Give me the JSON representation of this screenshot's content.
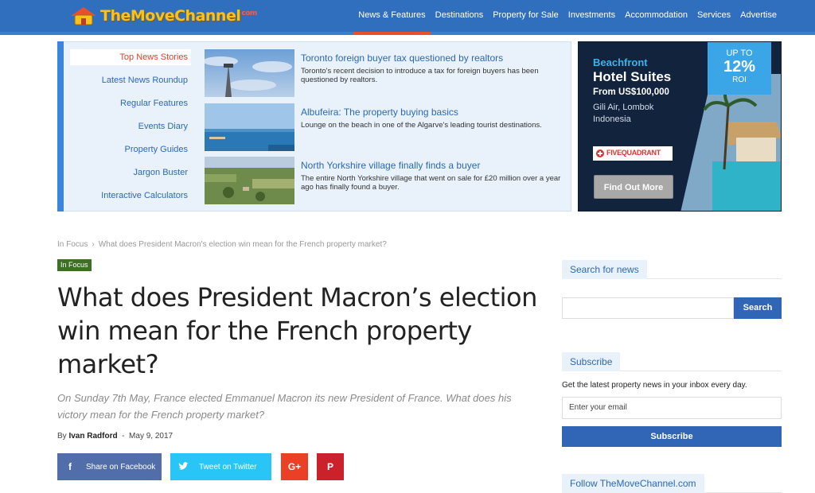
{
  "brand": {
    "logo_text": "TheMoveChannel",
    "logo_suffix": "com"
  },
  "nav": {
    "items": [
      "News & Features",
      "Destinations",
      "Property for Sale",
      "Investments",
      "Accommodation",
      "Services",
      "Advertise"
    ],
    "active": "News & Features"
  },
  "news_menu": {
    "items": [
      "Top News Stories",
      "Latest News Roundup",
      "Regular Features",
      "Events Diary",
      "Property Guides",
      "Jargon Buster",
      "Interactive Calculators"
    ]
  },
  "stories": [
    {
      "title": "Toronto foreign buyer tax questioned by realtors",
      "desc": "Toronto's recent decision to introduce a tax for foreign buyers has been questioned by realtors."
    },
    {
      "title": "Albufeira: The property buying basics",
      "desc": "Lounge on the beach in one of the Algarve's leading tourist destinations."
    },
    {
      "title": "North Yorkshire village finally finds a buyer",
      "desc": "The entire North Yorkshire village that went on sale for £20 million over a year ago has finally found a buyer."
    }
  ],
  "ad": {
    "kicker": "Beachfront",
    "title": "Hotel Suites",
    "price": "From US$100,000",
    "loc1": "Gili Air, Lombok",
    "loc2": "Indonesia",
    "badge_up": "UP TO",
    "badge_pct": "12%",
    "badge_roi": "ROI",
    "brand": "FIVEQUADRANT",
    "cta": "Find Out More"
  },
  "article": {
    "breadcrumb_root": "In Focus",
    "breadcrumb_sep": "›",
    "breadcrumb_current": "What does President Macron's election win mean for the French property market?",
    "tag": "In Focus",
    "headline": "What does President Macron’s election win mean for the French property market?",
    "subline": "On Sunday 7th May, France elected Emmanuel Macron its new President of France. What does his victory mean for the French property market?",
    "by": "By",
    "author": "Ivan Radford",
    "dash": "-",
    "date": "May 9, 2017"
  },
  "share": {
    "facebook": "Share on Facebook",
    "twitter": "Tweet on Twitter",
    "fb_icon": "f",
    "gp_icon": "G+",
    "pi_icon": "P"
  },
  "sidebar": {
    "search_head": "Search for news",
    "search_btn": "Search",
    "subscribe_head": "Subscribe",
    "subscribe_text": "Get the latest property news in your inbox every day.",
    "email_placeholder": "Enter your email",
    "subscribe_btn": "Subscribe",
    "follow_head": "Follow TheMoveChannel.com"
  }
}
